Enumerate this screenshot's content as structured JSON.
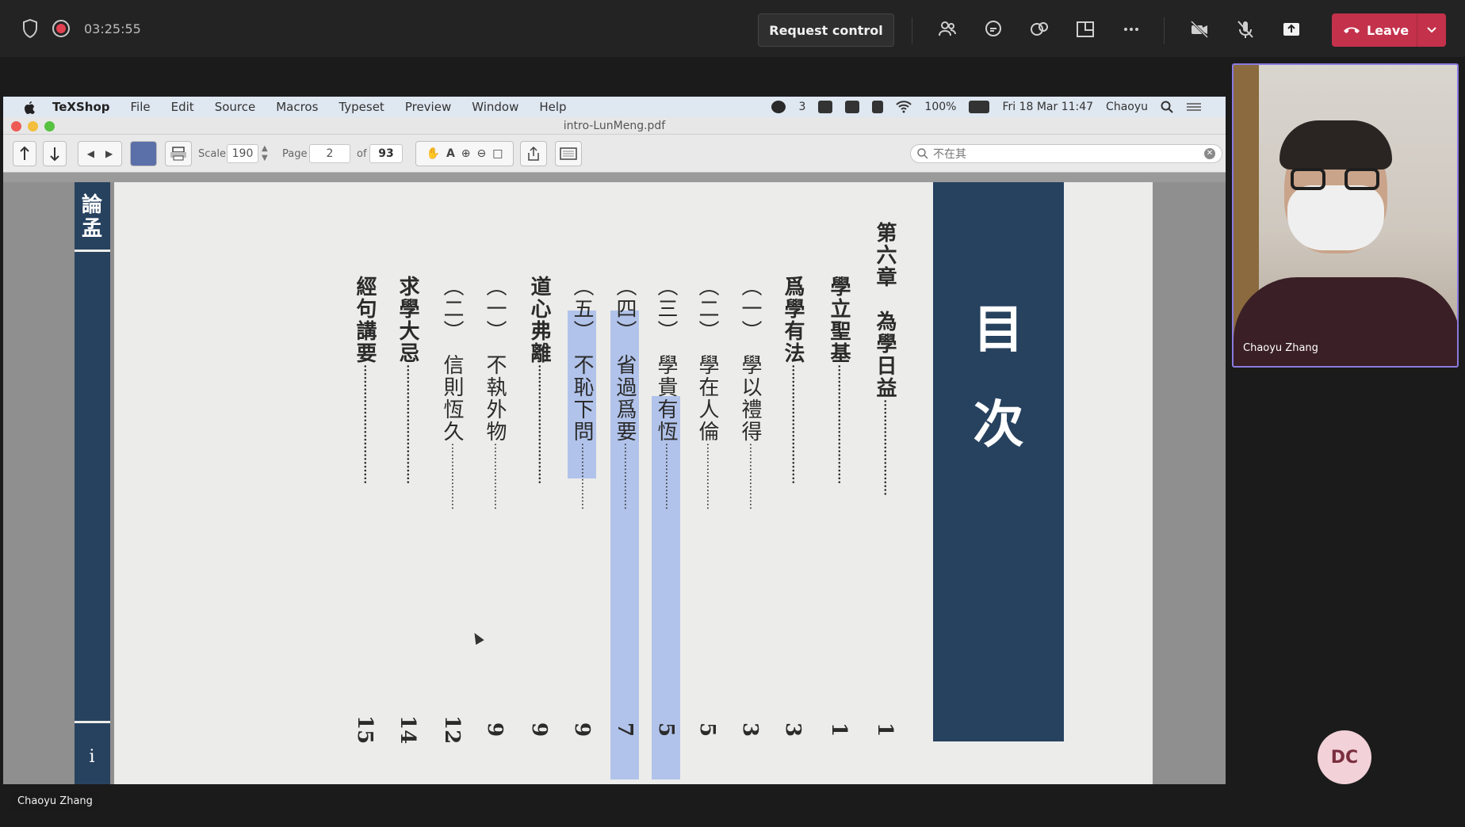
{
  "teams": {
    "timer": "03:25:55",
    "request_control": "Request control",
    "leave": "Leave",
    "presenter_name": "Chaoyu Zhang",
    "participant_video_name": "Chaoyu Zhang",
    "avatar_initials": "DC",
    "colors": {
      "leave": "#c4314b",
      "tile_border": "#8a7ae0",
      "avatar_bg": "#f2d1d8"
    }
  },
  "mac_menubar": {
    "items": [
      "TeXShop",
      "File",
      "Edit",
      "Source",
      "Macros",
      "Typeset",
      "Preview",
      "Window",
      "Help"
    ],
    "status_badge": "3",
    "battery": "100%",
    "datetime": "Fri 18 Mar 11:47",
    "user": "Chaoyu"
  },
  "window": {
    "title": "intro-LunMeng.pdf",
    "scale_label": "Scale",
    "scale_value": "190",
    "page_label": "Page",
    "page_value": "2",
    "of_label": "of",
    "page_total": "93",
    "search_value": "不在其"
  },
  "pdf": {
    "strip_label": "論孟",
    "page_roman": "i",
    "title_chars": [
      "目",
      "次"
    ],
    "colors": {
      "navy": "#27425f",
      "highlight": "#aec1ea",
      "paper": "#ececea"
    },
    "toc": [
      {
        "text": "第六章　為學日益",
        "page": "1",
        "bold": true
      },
      {
        "text": "學立聖基",
        "page": "1",
        "bold": true
      },
      {
        "text": "爲學有法",
        "page": "3",
        "bold": true
      },
      {
        "text": "（一）　學以禮得",
        "page": "3",
        "bold": false
      },
      {
        "text": "（二）　學在人倫",
        "page": "5",
        "bold": false
      },
      {
        "text": "（三）　學貴有恆",
        "page": "5",
        "bold": false
      },
      {
        "text": "（四）　省過爲要",
        "page": "7",
        "bold": false
      },
      {
        "text": "（五）　不恥下問",
        "page": "9",
        "bold": false
      },
      {
        "text": "道心弗離",
        "page": "9",
        "bold": true
      },
      {
        "text": "（一）　不執外物",
        "page": "9",
        "bold": false
      },
      {
        "text": "（二）　信則恆久",
        "page": "12",
        "bold": false
      },
      {
        "text": "求學大忌",
        "page": "14",
        "bold": true
      },
      {
        "text": "經句講要",
        "page": "15",
        "bold": true
      }
    ]
  }
}
